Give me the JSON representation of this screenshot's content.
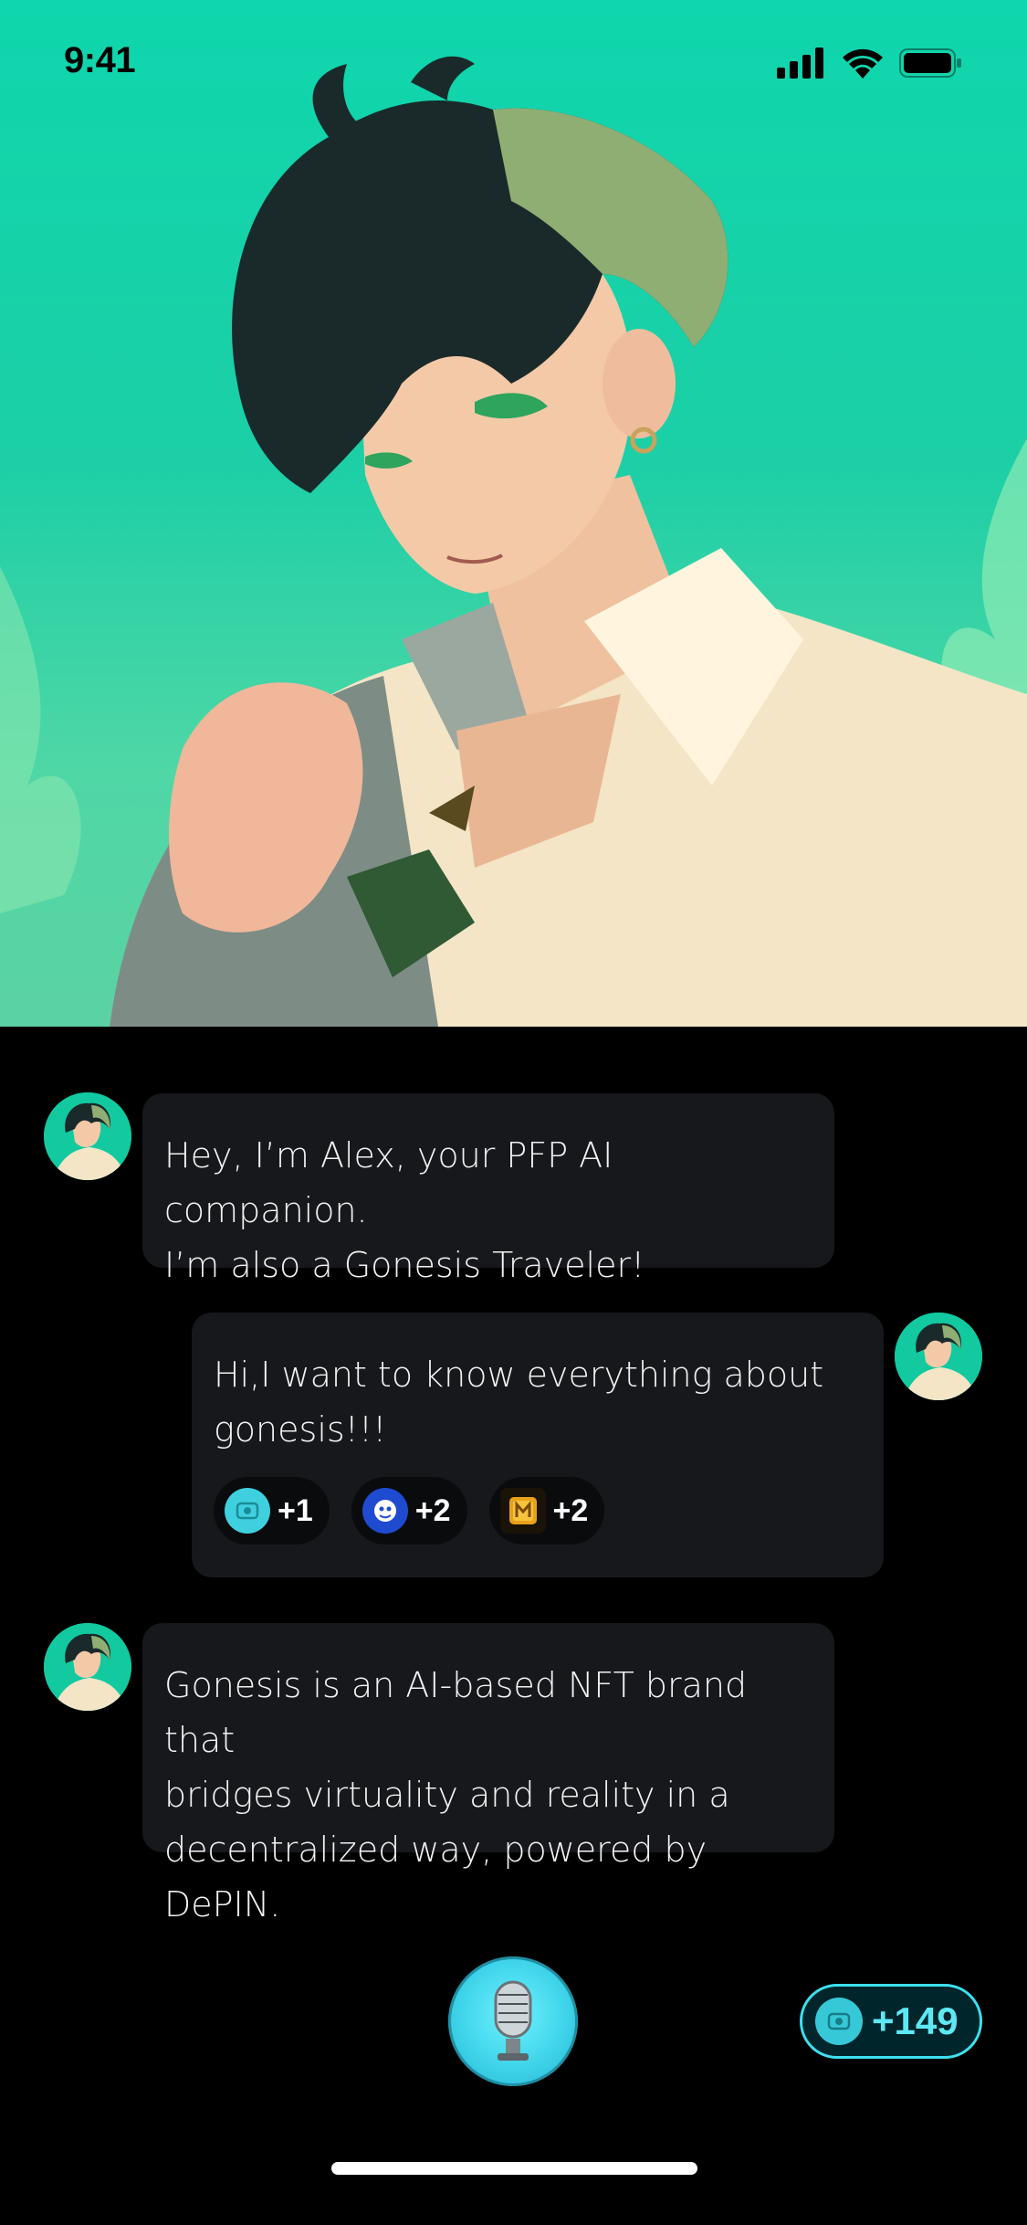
{
  "status_bar": {
    "time": "9:41"
  },
  "hero": {
    "character": "anime-style green-haired man in cream shirt"
  },
  "messages": [
    {
      "sender": "ai",
      "text": "Hey, I’m Alex, your PFP AI companion.\nI’m also a Gonesis Traveler!"
    },
    {
      "sender": "user",
      "text": "Hi,I want to know everything about\ngonesis!!!",
      "rewards": [
        {
          "icon": "token-icon",
          "label": "+1"
        },
        {
          "icon": "ape-icon",
          "label": "+2"
        },
        {
          "icon": "m-coin-icon",
          "label": "+2"
        }
      ]
    },
    {
      "sender": "ai",
      "text": "Gonesis is an AI-based NFT brand that\nbridges virtuality and reality in a\ndecentralized way, powered by DePIN."
    }
  ],
  "controls": {
    "mic": "microphone-icon",
    "points": "+149"
  },
  "colors": {
    "hero_bg": "#0fd6ad",
    "bubble_bg": "#16181c",
    "accent": "#3ee0ef"
  }
}
